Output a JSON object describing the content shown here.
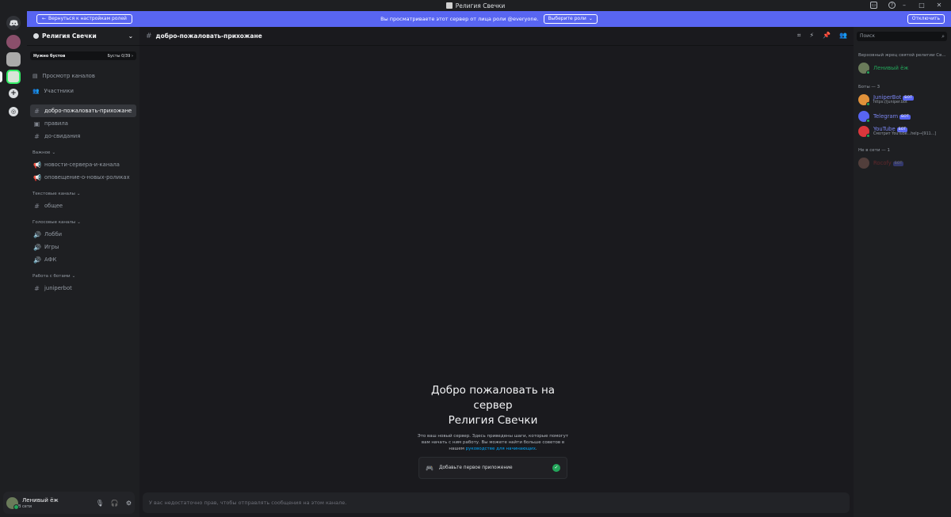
{
  "window": {
    "title": "Религия Свечки"
  },
  "banner": {
    "back_label": "Вернуться к настройкам ролей",
    "message": "Вы просматриваете этот сервер от лица роли @everyone.",
    "choose_roles_label": "Выберите роли",
    "disable_label": "Отключить"
  },
  "sidebar": {
    "server_name": "Религия Свечки",
    "boost_label": "Нужно бустов",
    "boost_count": "Бусты 0/39",
    "browse_channels": "Просмотр каналов",
    "members": "Участники",
    "channels": [
      {
        "name": "добро-пожаловать-прихожане",
        "icon": "hash-icon",
        "active": true
      },
      {
        "name": "правила",
        "icon": "rules-icon"
      },
      {
        "name": "до-свидания",
        "icon": "hash-icon"
      }
    ],
    "categories": [
      {
        "name": "Важное",
        "channels": [
          {
            "name": "новости-сервера-и-канала",
            "icon": "announcement-icon"
          },
          {
            "name": "оповещение-о-новых-роликах",
            "icon": "announcement-icon"
          }
        ]
      },
      {
        "name": "Текстовые каналы",
        "channels": [
          {
            "name": "общее",
            "icon": "hash-icon"
          }
        ]
      },
      {
        "name": "Голосовые каналы",
        "channels": [
          {
            "name": "Лобби",
            "icon": "speaker-icon"
          },
          {
            "name": "Игры",
            "icon": "speaker-icon"
          },
          {
            "name": "АФК",
            "icon": "speaker-icon"
          }
        ]
      },
      {
        "name": "Работа с ботами",
        "channels": [
          {
            "name": "juniperbot",
            "icon": "hash-icon"
          }
        ]
      }
    ]
  },
  "user": {
    "name": "Ленивый ёж",
    "status": "В сети"
  },
  "channel_header": {
    "name": "добро-пожаловать-прихожане"
  },
  "welcome": {
    "title_line1": "Добро пожаловать на",
    "title_line2": "сервер",
    "title_line3": "Религия Свечки",
    "text_before": "Это ваш новый сервер. Здесь приведены шаги, которые помогут вам начать с ним работу. Вы можете найти больше советов в нашем",
    "link": "руководстве для начинающих",
    "text_after": ".",
    "task": "Добавьте первое приложение"
  },
  "composer": {
    "placeholder": "У вас недостаточно прав, чтобы отправлять сообщения на этом канале."
  },
  "members": {
    "search_placeholder": "Поиск",
    "group1": "Верховный жрец святой религии Св...",
    "group1_members": [
      {
        "name": "Ленивый ёж",
        "color": "#23a55a"
      }
    ],
    "group2": "Боты — 3",
    "bots": [
      {
        "name": "JuniperBot",
        "sub": "https://juniper.bot",
        "tag": "БОТ",
        "color": "#e0913a"
      },
      {
        "name": "Telegram",
        "sub": "",
        "tag": "БОТ",
        "color": "#5865f2"
      },
      {
        "name": "YouTube",
        "sub": "Смотрит YouTube...help→[911...]",
        "tag": "БОТ",
        "color": "#da373c"
      }
    ],
    "group3": "Не в сети — 1",
    "offline": [
      {
        "name": "Rocofy",
        "tag": "БОТ"
      }
    ]
  }
}
